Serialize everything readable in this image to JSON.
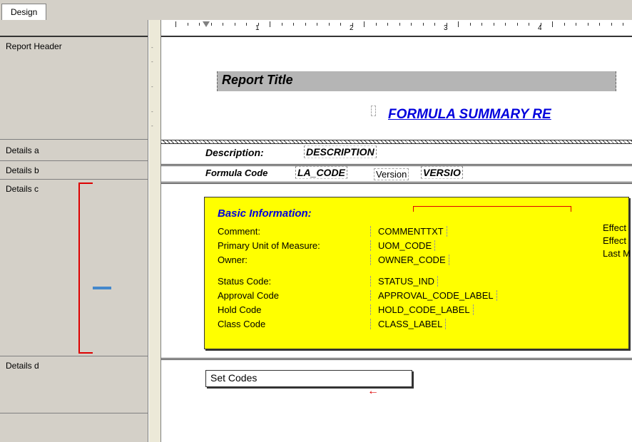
{
  "tab": {
    "design": "Design"
  },
  "ruler": {
    "marks": [
      "1",
      "2",
      "3",
      "4"
    ]
  },
  "sections": {
    "report_header": "Report Header",
    "details_a": "Details a",
    "details_b": "Details b",
    "details_c": "Details c",
    "details_d": "Details d"
  },
  "report_header": {
    "title": "Report Title",
    "link": "FORMULA SUMMARY RE"
  },
  "details_a": {
    "desc_label": "Description:",
    "desc_value": "DESCRIPTION"
  },
  "details_b": {
    "code_label": "Formula Code",
    "code_value": "LA_CODE",
    "version_label": "Version",
    "version_value": "VERSIO"
  },
  "basic_info": {
    "title": "Basic Information:",
    "rows": [
      {
        "label": "Comment:",
        "value": "COMMENTTXT"
      },
      {
        "label": "Primary Unit of Measure:",
        "value": "UOM_CODE"
      },
      {
        "label": "Owner:",
        "value": "OWNER_CODE"
      },
      {
        "label": "Status Code:",
        "value": "STATUS_IND"
      },
      {
        "label": "Approval Code",
        "value": "APPROVAL_CODE_LABEL"
      },
      {
        "label": "Hold Code",
        "value": "HOLD_CODE_LABEL"
      },
      {
        "label": "Class Code",
        "value": "CLASS_LABEL"
      }
    ],
    "right": [
      "Effect",
      "Effect",
      "Last M"
    ]
  },
  "details_d": {
    "setcodes": "Set Codes"
  }
}
